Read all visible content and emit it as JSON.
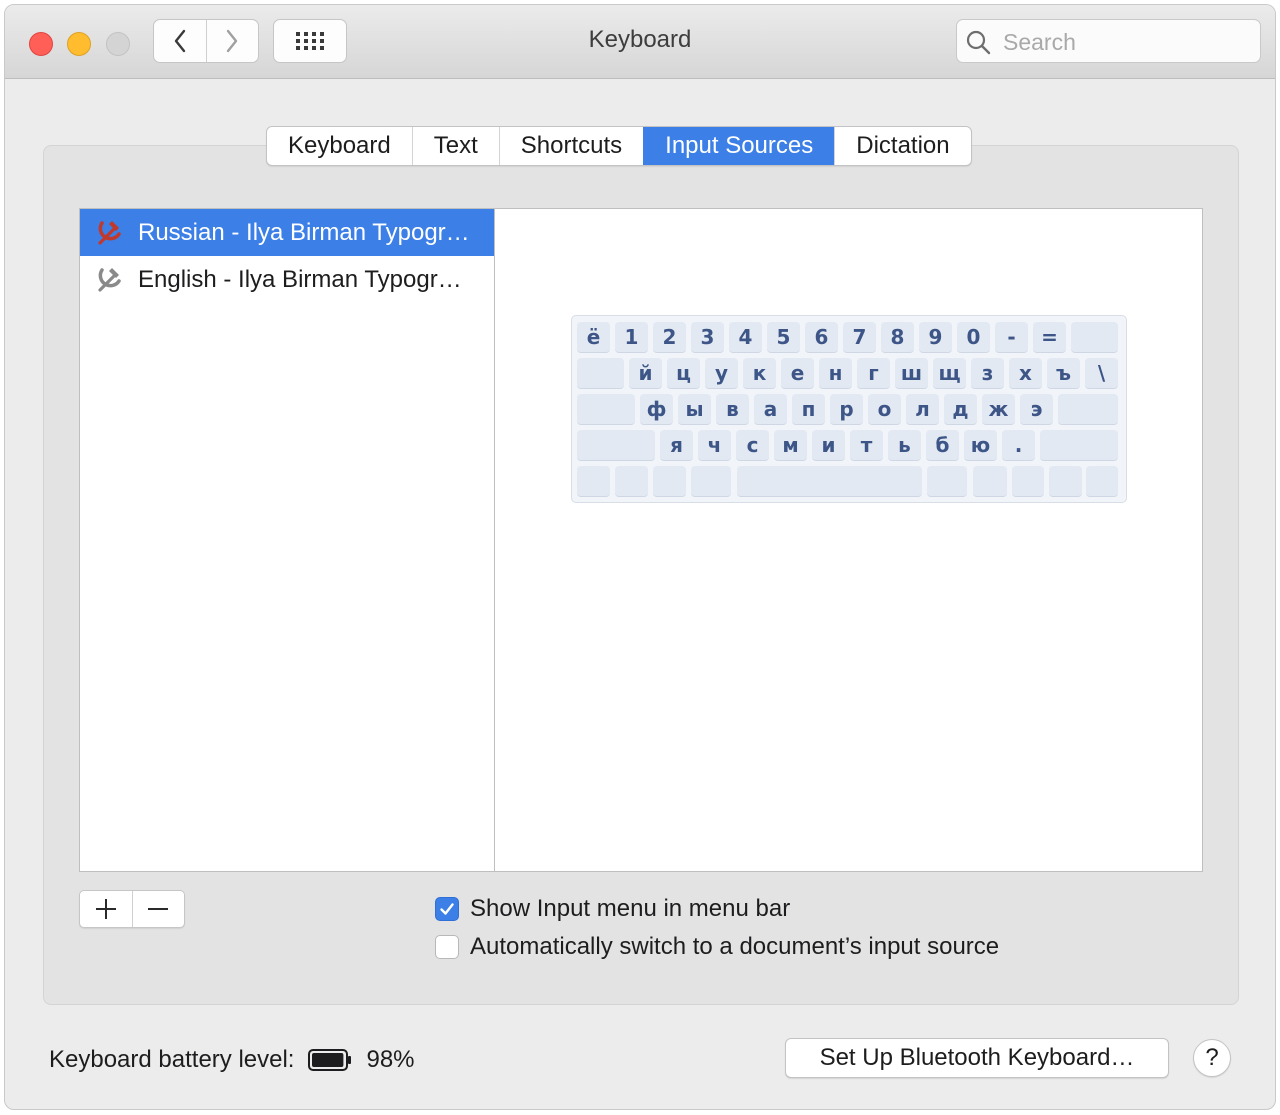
{
  "window": {
    "title": "Keyboard",
    "search_placeholder": "Search"
  },
  "tabs": [
    {
      "label": "Keyboard",
      "active": false
    },
    {
      "label": "Text",
      "active": false
    },
    {
      "label": "Shortcuts",
      "active": false
    },
    {
      "label": "Input Sources",
      "active": true
    },
    {
      "label": "Dictation",
      "active": false
    }
  ],
  "input_sources": [
    {
      "label": "Russian - Ilya Birman Typogr…",
      "icon": "hammer-sickle-icon",
      "icon_color": "#c0392b",
      "selected": true
    },
    {
      "label": "English - Ilya Birman Typogr…",
      "icon": "hammer-sickle-icon",
      "icon_color": "#8a8a8a",
      "selected": false
    }
  ],
  "keyboard_layout": {
    "row1": [
      "ё",
      "1",
      "2",
      "3",
      "4",
      "5",
      "6",
      "7",
      "8",
      "9",
      "0",
      "-",
      "="
    ],
    "row2": [
      "й",
      "ц",
      "у",
      "к",
      "е",
      "н",
      "г",
      "ш",
      "щ",
      "з",
      "х",
      "ъ",
      "\\"
    ],
    "row3": [
      "ф",
      "ы",
      "в",
      "а",
      "п",
      "р",
      "о",
      "л",
      "д",
      "ж",
      "э"
    ],
    "row4": [
      "я",
      "ч",
      "с",
      "м",
      "и",
      "т",
      "ь",
      "б",
      "ю",
      "."
    ]
  },
  "list_buttons": {
    "add": "+",
    "remove": "—"
  },
  "options": {
    "show_input_menu": {
      "label": "Show Input menu in menu bar",
      "checked": true
    },
    "auto_switch": {
      "label": "Automatically switch to a document’s input source",
      "checked": false
    }
  },
  "footer": {
    "battery_label": "Keyboard battery level:",
    "battery_value": "98%",
    "battery_fraction": 0.98,
    "bluetooth_button": "Set Up Bluetooth Keyboard…",
    "help_label": "?"
  },
  "colors": {
    "accent": "#3b7fe7",
    "close": "#ff5f57",
    "minimize": "#febc2e",
    "zoom_disabled": "#d4d4d4"
  }
}
